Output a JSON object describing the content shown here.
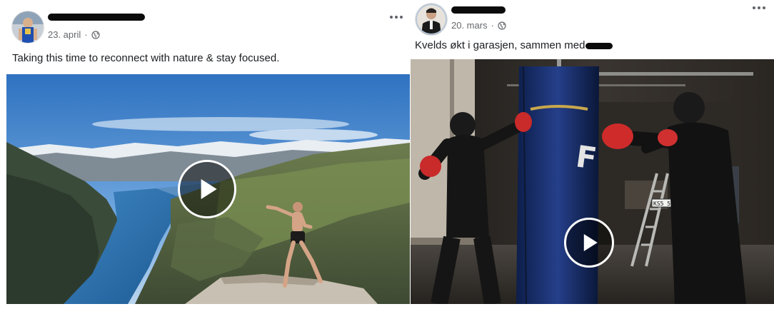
{
  "posts": [
    {
      "date": "23. april",
      "visibility_icon": "globe-icon",
      "caption": "Taking this time to reconnect with nature & stay focused.",
      "media": {
        "type": "video",
        "scene": "mountain-fjord-shadowboxing",
        "play_icon": "play-icon"
      }
    },
    {
      "date": "20. mars",
      "visibility_icon": "globe-icon",
      "caption": "Kvelds økt i garasjen, sammen med",
      "media": {
        "type": "video",
        "scene": "garage-boxing-heavy-bag",
        "play_icon": "play-icon",
        "license_plate": "KS5 5132"
      }
    }
  ],
  "icons": {
    "more": "more-options-icon",
    "globe": "globe-icon",
    "play": "play-icon"
  },
  "colors": {
    "meta_text": "#65676b",
    "body_text": "#1c1e21",
    "redaction": "#0b0b0b"
  }
}
